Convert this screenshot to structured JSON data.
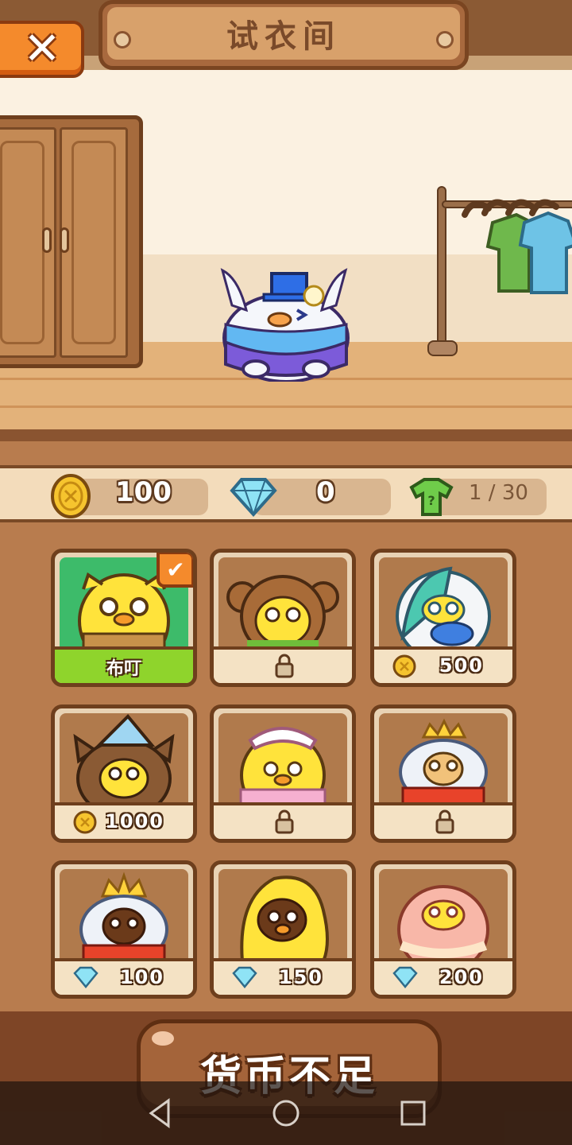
{
  "header": {
    "title": "试衣间"
  },
  "close_button": {
    "symbol": "✕",
    "icon": "close-icon"
  },
  "stats": {
    "coins": "100",
    "diamonds": "0",
    "outfits_owned": "1 / 30"
  },
  "skins": [
    {
      "name": "布叮",
      "state": "selected",
      "currency": "",
      "price": ""
    },
    {
      "name": "",
      "state": "locked",
      "currency": "",
      "price": ""
    },
    {
      "name": "",
      "state": "buy",
      "currency": "coin",
      "price": "500"
    },
    {
      "name": "",
      "state": "buy",
      "currency": "coin",
      "price": "1000"
    },
    {
      "name": "",
      "state": "locked",
      "currency": "",
      "price": ""
    },
    {
      "name": "",
      "state": "locked",
      "currency": "",
      "price": ""
    },
    {
      "name": "",
      "state": "buy",
      "currency": "diamond",
      "price": "100"
    },
    {
      "name": "",
      "state": "buy",
      "currency": "diamond",
      "price": "150"
    },
    {
      "name": "",
      "state": "buy",
      "currency": "diamond",
      "price": "200"
    }
  ],
  "action_button": {
    "label": "货币不足"
  },
  "check_symbol": "✔",
  "colors": {
    "accent": "#f48a2c",
    "selected_bg": "#3dbb6a",
    "selected_foot": "#8fd42c"
  }
}
